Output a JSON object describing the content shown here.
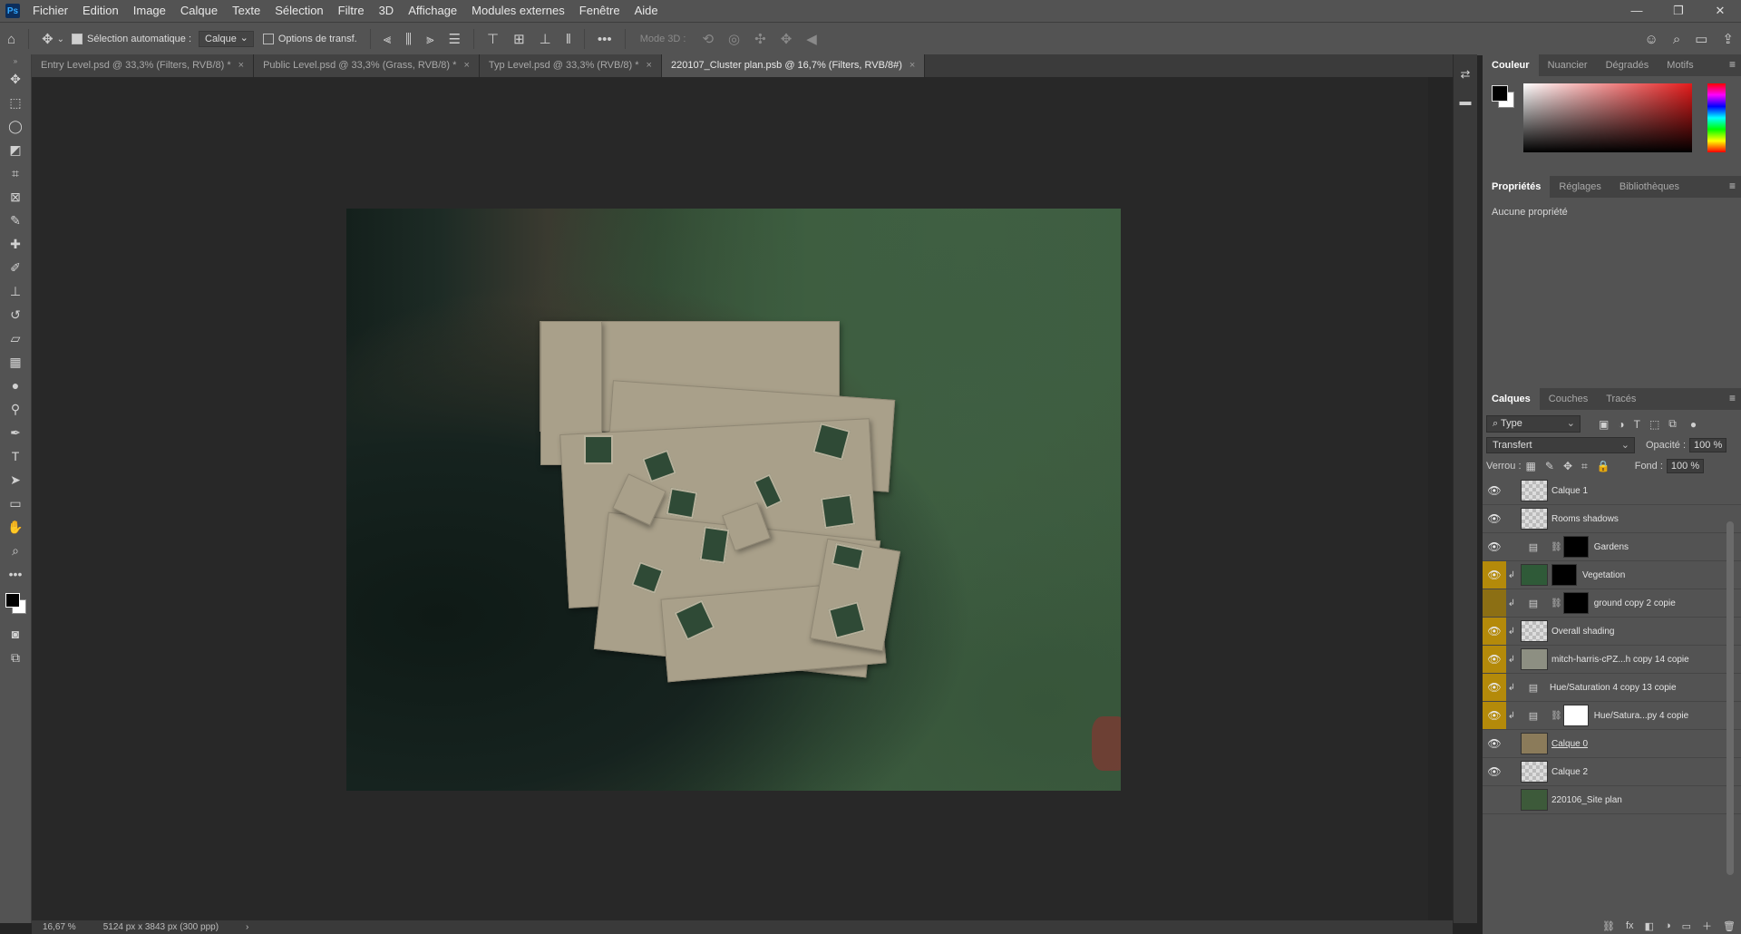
{
  "menubar": {
    "logo": "Ps",
    "items": [
      "Fichier",
      "Edition",
      "Image",
      "Calque",
      "Texte",
      "Sélection",
      "Filtre",
      "3D",
      "Affichage",
      "Modules externes",
      "Fenêtre",
      "Aide"
    ],
    "window_buttons": [
      "—",
      "❐",
      "✕"
    ]
  },
  "options_bar": {
    "auto_select_label": "Sélection automatique :",
    "auto_select_value": "Calque",
    "transform_label": "Options de transf.",
    "more": "•••",
    "mode3d": "Mode 3D :"
  },
  "tabs": [
    {
      "label": "Entry Level.psd @ 33,3% (Filters, RVB/8) *",
      "close": "×"
    },
    {
      "label": "Public Level.psd @ 33,3% (Grass, RVB/8) *",
      "close": "×"
    },
    {
      "label": "Typ Level.psd @ 33,3% (RVB/8) *",
      "close": "×"
    },
    {
      "label": "220107_Cluster plan.psb @ 16,7% (Filters, RVB/8#)",
      "close": "×"
    }
  ],
  "status_bar": {
    "zoom": "16,67 %",
    "doc_info": "5124 px x 3843 px (300 ppp)",
    "arrow": "›"
  },
  "color_panel": {
    "tabs": [
      "Couleur",
      "Nuancier",
      "Dégradés",
      "Motifs"
    ],
    "menu": "≡"
  },
  "properties_panel": {
    "tabs": [
      "Propriétés",
      "Réglages",
      "Bibliothèques"
    ],
    "menu": "≡",
    "empty_text": "Aucune propriété"
  },
  "layers_panel": {
    "tabs": [
      "Calques",
      "Couches",
      "Tracés"
    ],
    "menu": "≡",
    "filter_type": "Type",
    "blend_mode": "Transfert",
    "opacity_label": "Opacité :",
    "opacity_value": "100 %",
    "lock_label": "Verrou :",
    "fill_label": "Fond :",
    "fill_value": "100 %",
    "layers": [
      {
        "name": "Calque 1"
      },
      {
        "name": "Rooms shadows"
      },
      {
        "name": "Gardens"
      },
      {
        "name": "Vegetation"
      },
      {
        "name": "ground copy 2 copie"
      },
      {
        "name": "Overall shading"
      },
      {
        "name": "mitch-harris-cPZ...h copy 14 copie"
      },
      {
        "name": "Hue/Saturation 4 copy 13 copie"
      },
      {
        "name": "Hue/Satura...py 4 copie"
      },
      {
        "name": "Calque 0"
      },
      {
        "name": "Calque 2"
      },
      {
        "name": "220106_Site plan"
      }
    ],
    "footer_icons": [
      "⛓",
      "fx",
      "◧",
      "◑",
      "▭",
      "＋",
      "🗑"
    ]
  },
  "colors": {
    "highlight": "#b48a0a",
    "panel": "#535353",
    "canvas_bg": "#282828"
  }
}
